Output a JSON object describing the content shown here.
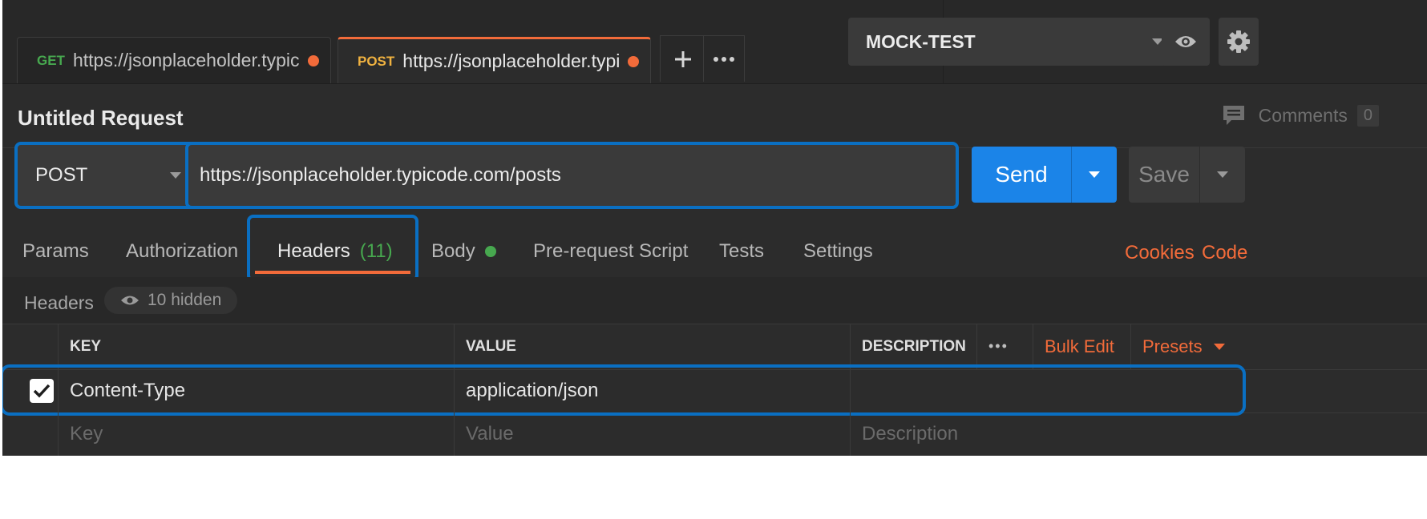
{
  "tabs": [
    {
      "method": "GET",
      "url": "https://jsonplaceholder.typicod...",
      "unsaved": true
    },
    {
      "method": "POST",
      "url": "https://jsonplaceholder.typico...",
      "unsaved": true,
      "active": true
    }
  ],
  "tab_actions": {
    "new_tab_icon": "plus-icon",
    "more_icon": "ellipsis-icon"
  },
  "environment": {
    "selected": "MOCK-TEST",
    "eye_icon": "eye-icon",
    "settings_icon": "gear-icon"
  },
  "request": {
    "title": "Untitled Request",
    "comments_label": "Comments",
    "comments_count": "0",
    "method": "POST",
    "url": "https://jsonplaceholder.typicode.com/posts",
    "send_label": "Send",
    "save_label": "Save"
  },
  "subtabs": {
    "params": "Params",
    "authorization": "Authorization",
    "headers": "Headers",
    "headers_count": "(11)",
    "body": "Body",
    "prerequest": "Pre-request Script",
    "tests": "Tests",
    "settings": "Settings",
    "cookies": "Cookies",
    "code": "Code"
  },
  "headers_section": {
    "label": "Headers",
    "hidden": "10 hidden"
  },
  "table": {
    "columns": {
      "key": "KEY",
      "value": "VALUE",
      "description": "DESCRIPTION"
    },
    "actions": {
      "more": "•••",
      "bulk_edit": "Bulk Edit",
      "presets": "Presets"
    },
    "rows": [
      {
        "checked": true,
        "key": "Content-Type",
        "value": "application/json",
        "description": ""
      }
    ],
    "placeholders": {
      "key": "Key",
      "value": "Value",
      "description": "Description"
    }
  },
  "colors": {
    "accent": "#f26b3a",
    "send": "#1b84e8",
    "highlight": "#0a6fc2",
    "get": "#47a84f",
    "post": "#f0b240"
  }
}
